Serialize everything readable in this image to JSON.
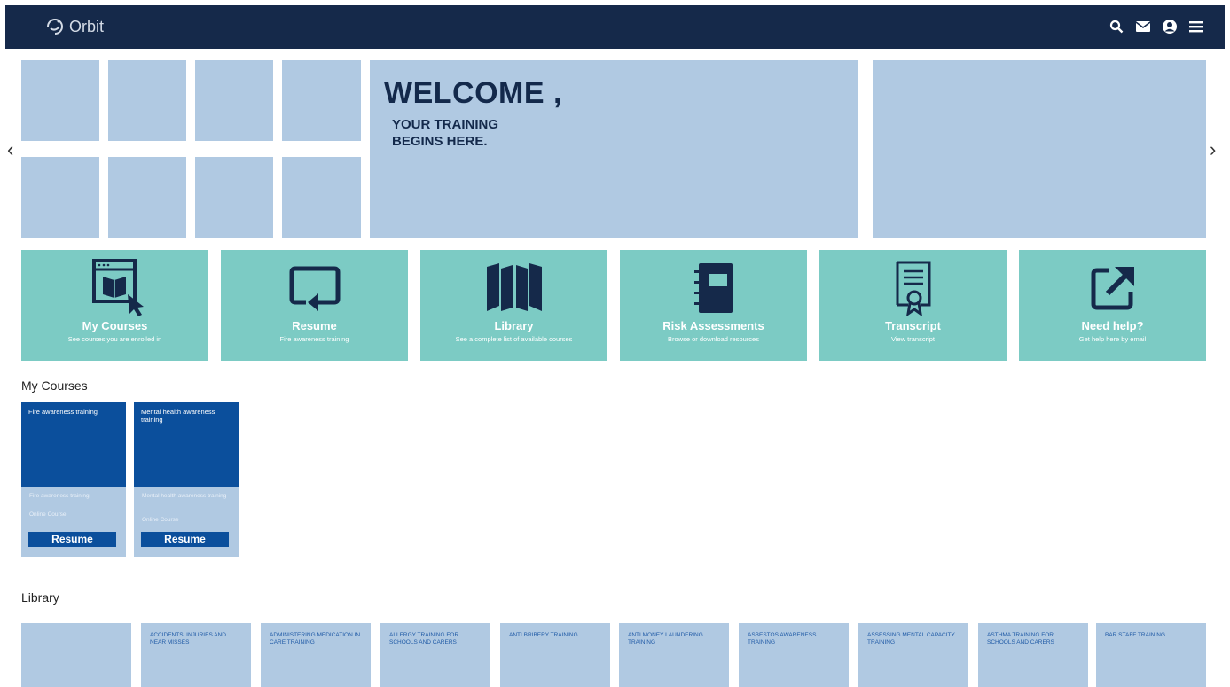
{
  "header": {
    "brand": "Orbit",
    "icons": [
      "search-icon",
      "mail-icon",
      "user-icon",
      "menu-icon"
    ]
  },
  "hero": {
    "title": "WELCOME ,",
    "subtitle_line1": "YOUR TRAINING",
    "subtitle_line2": "BEGINS HERE."
  },
  "quick_links": [
    {
      "title": "My Courses",
      "subtitle": "See courses you are enrolled in",
      "icon": "courses-icon"
    },
    {
      "title": "Resume",
      "subtitle": "Fire awareness training",
      "icon": "resume-icon"
    },
    {
      "title": "Library",
      "subtitle": "See a complete list of available courses",
      "icon": "library-icon"
    },
    {
      "title": "Risk Assessments",
      "subtitle": "Browse or download resources",
      "icon": "notebook-icon"
    },
    {
      "title": "Transcript",
      "subtitle": "View transcript",
      "icon": "certificate-icon"
    },
    {
      "title": "Need help?",
      "subtitle": "Get help here by email",
      "icon": "external-link-icon"
    }
  ],
  "sections": {
    "my_courses": "My Courses",
    "library": "Library"
  },
  "courses": [
    {
      "title": "Fire awareness training",
      "name": "Fire awareness training",
      "type": "Online Course",
      "button": "Resume"
    },
    {
      "title": "Mental health awareness training",
      "name": "Mental health awareness training",
      "type": "Online Course",
      "button": "Resume"
    }
  ],
  "library": [
    "",
    "ACCIDENTS, INJURIES AND NEAR MISSES",
    "ADMINISTERING MEDICATION IN CARE TRAINING",
    "ALLERGY TRAINING FOR SCHOOLS AND CARERS",
    "ANTI BRIBERY TRAINING",
    "ANTI MONEY LAUNDERING TRAINING",
    "ASBESTOS AWARENESS TRAINING",
    "ASSESSING MENTAL CAPACITY TRAINING",
    "ASTHMA TRAINING FOR SCHOOLS AND CARERS",
    "BAR STAFF TRAINING"
  ],
  "colors": {
    "header_bg": "#15294a",
    "tile": "#b0c9e2",
    "quick_card": "#7ccbc4",
    "course_dark": "#0b4f9c"
  }
}
